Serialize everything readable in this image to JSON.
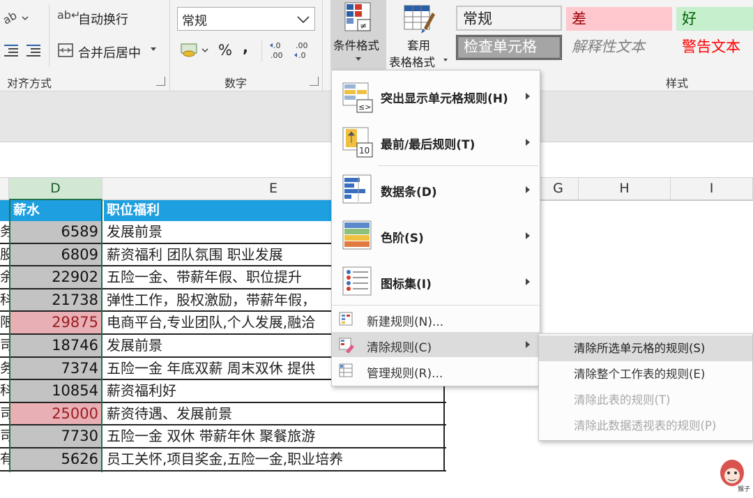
{
  "ribbon": {
    "alignment": {
      "wrap_text": "自动换行",
      "merge_center": "合并后居中",
      "group_label": "对齐方式"
    },
    "number": {
      "format_value": "常规",
      "percent": "%",
      "comma": ",",
      "inc_decimal": "←.0\n.00",
      "dec_decimal": ".00\n→.0",
      "group_label": "数字"
    },
    "conditional_format": {
      "label": "条件格式"
    },
    "table_format": {
      "label_line1": "套用",
      "label_line2": "表格格式"
    },
    "styles": {
      "group_label": "样式",
      "cells": [
        {
          "text": "常规",
          "color": "#222222",
          "bg": "#ffffff"
        },
        {
          "text": "差",
          "color": "#9c0006",
          "bg": "#ffc7ce"
        },
        {
          "text": "好",
          "color": "#006100",
          "bg": "#c6efce"
        },
        {
          "text": "检查单元格",
          "color": "#ffffff",
          "bg": "#a5a5a5"
        },
        {
          "text": "解释性文本",
          "color": "#7f7f7f",
          "bg": "#f3f3f3"
        },
        {
          "text": "警告文本",
          "color": "#ff0000",
          "bg": "#f3f3f3"
        }
      ]
    }
  },
  "sheet": {
    "columns": [
      "D",
      "E",
      "G",
      "H",
      "I"
    ],
    "header_row": {
      "d": "薪水",
      "e": "职位福利"
    },
    "left_clip": [
      "务",
      "股",
      "余",
      "科",
      "限",
      "司",
      "务",
      "科",
      "司",
      "司",
      "有"
    ],
    "rows": [
      {
        "d": "6589",
        "e": "发展前景",
        "highlight": false
      },
      {
        "d": "6809",
        "e": "薪资福利 团队氛围 职业发展",
        "highlight": false
      },
      {
        "d": "22902",
        "e": "五险一金、带薪年假、职位提升",
        "highlight": false
      },
      {
        "d": "21738",
        "e": "弹性工作，股权激励，带薪年假，",
        "highlight": false
      },
      {
        "d": "29875",
        "e": "电商平台,专业团队,个人发展,融洽",
        "highlight": true
      },
      {
        "d": "18746",
        "e": "发展前景",
        "highlight": false
      },
      {
        "d": "7374",
        "e": "五险一金 年底双薪 周末双休 提供",
        "highlight": false
      },
      {
        "d": "10854",
        "e": "薪资福利好",
        "highlight": false
      },
      {
        "d": "25000",
        "e": "薪资待遇、发展前景",
        "highlight": true
      },
      {
        "d": "7730",
        "e": "五险一金 双休 带薪年休 聚餐旅游",
        "highlight": false
      },
      {
        "d": "5626",
        "e": "员工关怀,项目奖金,五险一金,职业培养",
        "highlight": false
      }
    ]
  },
  "cf_menu": {
    "big_items": [
      {
        "label": "突出显示单元格规则(H)",
        "icon": "highlight-rules-icon"
      },
      {
        "label": "最前/最后规则(T)",
        "icon": "top-bottom-rules-icon"
      },
      {
        "label": "数据条(D)",
        "icon": "data-bars-icon"
      },
      {
        "label": "色阶(S)",
        "icon": "color-scales-icon"
      },
      {
        "label": "图标集(I)",
        "icon": "icon-sets-icon"
      }
    ],
    "small_items": [
      {
        "label": "新建规则(N)...",
        "icon": "new-rule-icon"
      },
      {
        "label": "清除规则(C)",
        "icon": "clear-rules-icon"
      },
      {
        "label": "管理规则(R)...",
        "icon": "manage-rules-icon"
      }
    ]
  },
  "sub_menu": {
    "items": [
      {
        "label": "清除所选单元格的规则(S)",
        "state": "active"
      },
      {
        "label": "清除整个工作表的规则(E)",
        "state": "normal"
      },
      {
        "label": "清除此表的规则(T)",
        "state": "disabled"
      },
      {
        "label": "清除此数据透视表的规则(P)",
        "state": "disabled"
      }
    ]
  },
  "watermark": {
    "text": "猴子"
  }
}
